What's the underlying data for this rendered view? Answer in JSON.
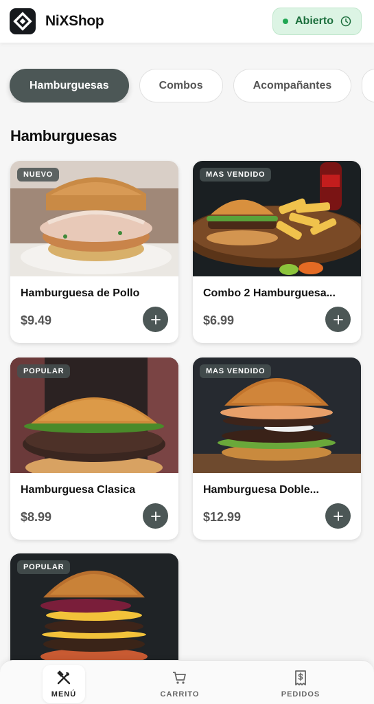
{
  "header": {
    "app_name": "NiXShop",
    "status": {
      "label": "Abierto",
      "icon": "clock-icon",
      "color": "#1fa653"
    }
  },
  "categories": [
    {
      "label": "Hamburguesas",
      "active": true
    },
    {
      "label": "Combos",
      "active": false
    },
    {
      "label": "Acompañantes",
      "active": false
    }
  ],
  "section": {
    "title": "Hamburguesas"
  },
  "products": [
    {
      "badge": "NUEVO",
      "name": "Hamburguesa de Pollo",
      "price": "$9.49"
    },
    {
      "badge": "MAS VENDIDO",
      "name": "Combo 2 Hamburguesa...",
      "price": "$6.99"
    },
    {
      "badge": "POPULAR",
      "name": "Hamburguesa Clasica",
      "price": "$8.99"
    },
    {
      "badge": "MAS VENDIDO",
      "name": "Hamburguesa Doble...",
      "price": "$12.99"
    },
    {
      "badge": "POPULAR",
      "name": "",
      "price": ""
    }
  ],
  "nav": [
    {
      "label": "MENÚ",
      "icon": "utensils-icon",
      "active": true
    },
    {
      "label": "CARRITO",
      "icon": "cart-icon",
      "active": false
    },
    {
      "label": "PEDIDOS",
      "icon": "receipt-icon",
      "active": false
    }
  ],
  "colors": {
    "accent": "#4c5756",
    "status_bg": "#dcf4e4",
    "status_text": "#1b6e3c"
  }
}
